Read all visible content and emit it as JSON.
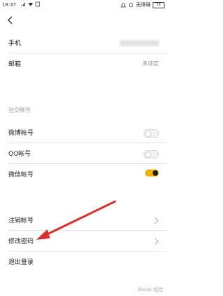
{
  "status": {
    "time": "18:37",
    "network_label": "无障碍",
    "battery": "36"
  },
  "contact": [
    {
      "label": "手机",
      "value": ""
    },
    {
      "label": "邮箱",
      "value": "未绑定"
    }
  ],
  "social_section_title": "社交帐号",
  "social": [
    {
      "label": "微博帐号",
      "on": false
    },
    {
      "label": "QQ帐号",
      "on": false
    },
    {
      "label": "微信帐号",
      "on": true
    }
  ],
  "actions": [
    {
      "label": "注销帐号"
    },
    {
      "label": "修改密码"
    },
    {
      "label": "退出登录"
    }
  ],
  "watermark": "Baidu 经验",
  "colors": {
    "toggle_on": "#f0b400",
    "annotation_arrow": "#d9302c"
  }
}
